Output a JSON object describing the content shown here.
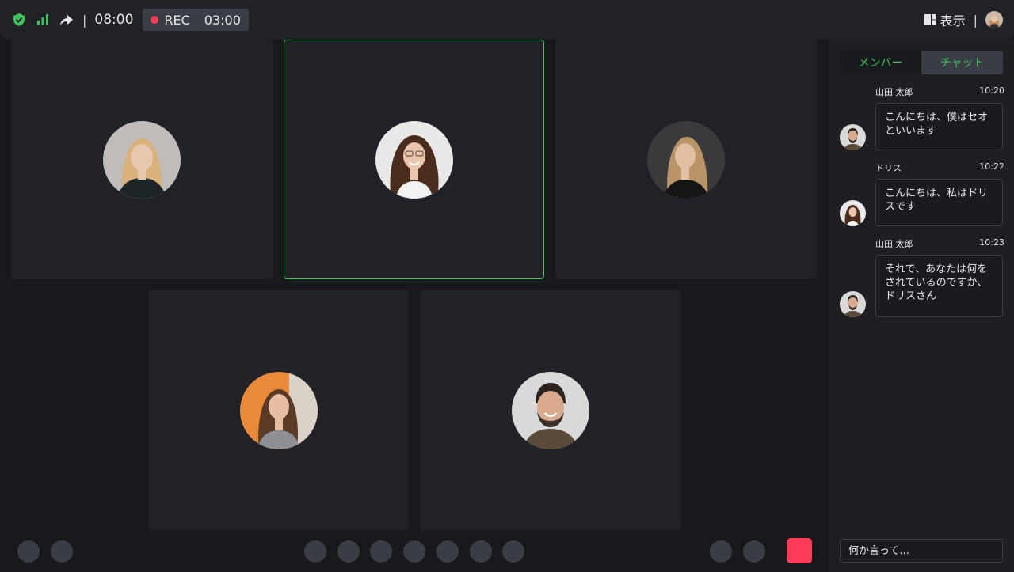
{
  "topbar": {
    "time": "08:00",
    "separator": "|",
    "rec_label": "REC",
    "rec_time": "03:00",
    "view_label": "表示",
    "icons": [
      "shield-check-icon",
      "signal-bars-icon",
      "share-arrow-icon",
      "layout-icon"
    ]
  },
  "participants": [
    {
      "name": "participant-1",
      "skin": "#e7c7ae",
      "hair": "#d8b27a",
      "bg": "#bfbcba",
      "shirt": "#1b2426"
    },
    {
      "name": "participant-2",
      "skin": "#e9c6ad",
      "hair": "#4a2c1d",
      "bg": "#e8e8e8",
      "shirt": "#f2f2f2"
    },
    {
      "name": "participant-3",
      "skin": "#e3bfa4",
      "hair": "#b89466",
      "bg": "#3a3a3d",
      "shirt": "#151515"
    },
    {
      "name": "participant-4",
      "skin": "#e6bfa3",
      "hair": "#5c3b26",
      "bg": "#e88a3a",
      "shirt": "#8e8f95"
    },
    {
      "name": "participant-5",
      "skin": "#d9aa8e",
      "hair": "#2a2320",
      "bg": "#d9d9d9",
      "shirt": "#5a4a37"
    }
  ],
  "panel": {
    "tabs": [
      {
        "label": "メンバー",
        "selected": false
      },
      {
        "label": "チャット",
        "selected": true
      }
    ],
    "messages": [
      {
        "author": "山田 太郎",
        "time": "10:20",
        "text": "こんにちは、僕はセオといいます"
      },
      {
        "author": "ドリス",
        "time": "10:22",
        "text": "こんにちは、私はドリスです"
      },
      {
        "author": "山田 太郎",
        "time": "10:23",
        "text": "それで、あなたは何をされているのですか、ドリスさん"
      }
    ],
    "input_placeholder": "何か言って..."
  },
  "colors": {
    "accent": "#3cc35a",
    "record": "#ff3b57",
    "tile": "#202228",
    "background": "#18191c"
  }
}
